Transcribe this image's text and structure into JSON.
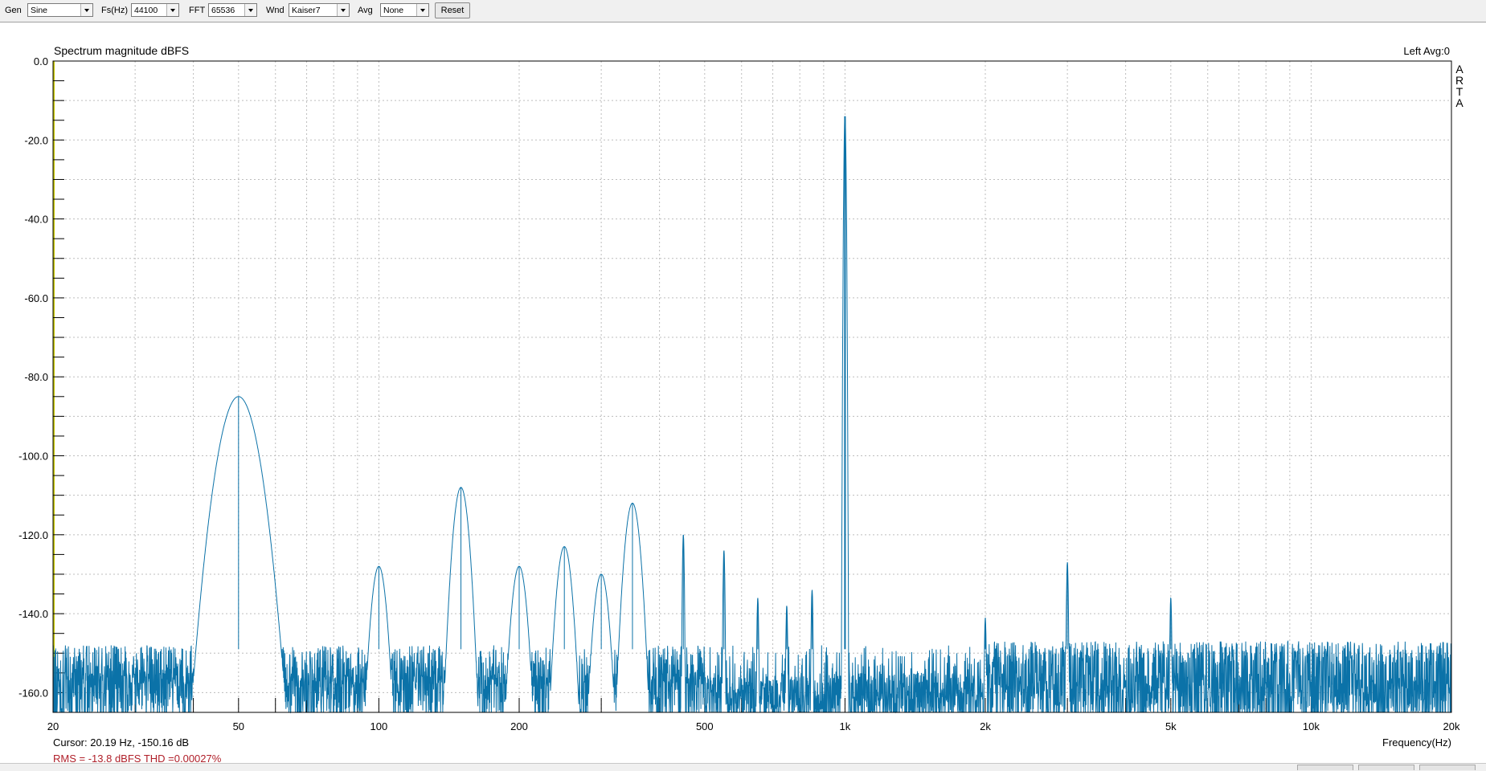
{
  "toolbar": {
    "gen_label": "Gen",
    "gen_value": "Sine",
    "fs_label": "Fs(Hz)",
    "fs_value": "44100",
    "fft_label": "FFT",
    "fft_value": "65536",
    "wnd_label": "Wnd",
    "wnd_value": "Kaiser7",
    "avg_label": "Avg",
    "avg_value": "None",
    "reset_label": "Reset"
  },
  "colors": {
    "trace": "#0b72a8",
    "grid": "#bdbdbd",
    "status_red": "#b0202a",
    "axis_accent": "#c8c800"
  },
  "chart_data": {
    "type": "line",
    "title": "Spectrum magnitude dBFS",
    "channel_info": "Left  Avg:0",
    "brand_letters": [
      "A",
      "R",
      "T",
      "A"
    ],
    "xlabel": "Frequency(Hz)",
    "ylabel": "",
    "x_scale": "log",
    "xlim": [
      20,
      20000
    ],
    "ylim": [
      -165,
      0
    ],
    "grid": true,
    "y_ticks": [
      {
        "value": 0,
        "label": "0.0"
      },
      {
        "value": -20,
        "label": "-20.0"
      },
      {
        "value": -40,
        "label": "-40.0"
      },
      {
        "value": -60,
        "label": "-60.0"
      },
      {
        "value": -80,
        "label": "-80.0"
      },
      {
        "value": -100,
        "label": "-100.0"
      },
      {
        "value": -120,
        "label": "-120.0"
      },
      {
        "value": -140,
        "label": "-140.0"
      },
      {
        "value": -160,
        "label": "-160.0"
      }
    ],
    "x_ticks": [
      {
        "value": 20,
        "label": "20"
      },
      {
        "value": 50,
        "label": "50"
      },
      {
        "value": 100,
        "label": "100"
      },
      {
        "value": 200,
        "label": "200"
      },
      {
        "value": 500,
        "label": "500"
      },
      {
        "value": 1000,
        "label": "1k"
      },
      {
        "value": 2000,
        "label": "2k"
      },
      {
        "value": 5000,
        "label": "5k"
      },
      {
        "value": 10000,
        "label": "10k"
      },
      {
        "value": 20000,
        "label": "20k"
      }
    ],
    "x_gridlines": [
      20,
      30,
      40,
      50,
      60,
      70,
      80,
      90,
      100,
      200,
      300,
      400,
      500,
      600,
      700,
      800,
      900,
      1000,
      2000,
      3000,
      4000,
      5000,
      6000,
      7000,
      8000,
      9000,
      10000,
      20000
    ],
    "noise_floor_db": -155,
    "peaks": [
      {
        "freq": 50,
        "db": -85
      },
      {
        "freq": 100,
        "db": -128
      },
      {
        "freq": 150,
        "db": -108
      },
      {
        "freq": 200,
        "db": -128
      },
      {
        "freq": 250,
        "db": -123
      },
      {
        "freq": 300,
        "db": -130
      },
      {
        "freq": 350,
        "db": -112
      },
      {
        "freq": 450,
        "db": -120
      },
      {
        "freq": 550,
        "db": -124
      },
      {
        "freq": 650,
        "db": -136
      },
      {
        "freq": 750,
        "db": -138
      },
      {
        "freq": 850,
        "db": -134
      },
      {
        "freq": 1000,
        "db": -14
      },
      {
        "freq": 2000,
        "db": -141
      },
      {
        "freq": 3000,
        "db": -127
      },
      {
        "freq": 5000,
        "db": -136
      }
    ],
    "cursor_text": "Cursor: 20.19 Hz, -150.16 dB",
    "status_text": "RMS =  -13.8 dBFS   THD =0.00027%"
  }
}
